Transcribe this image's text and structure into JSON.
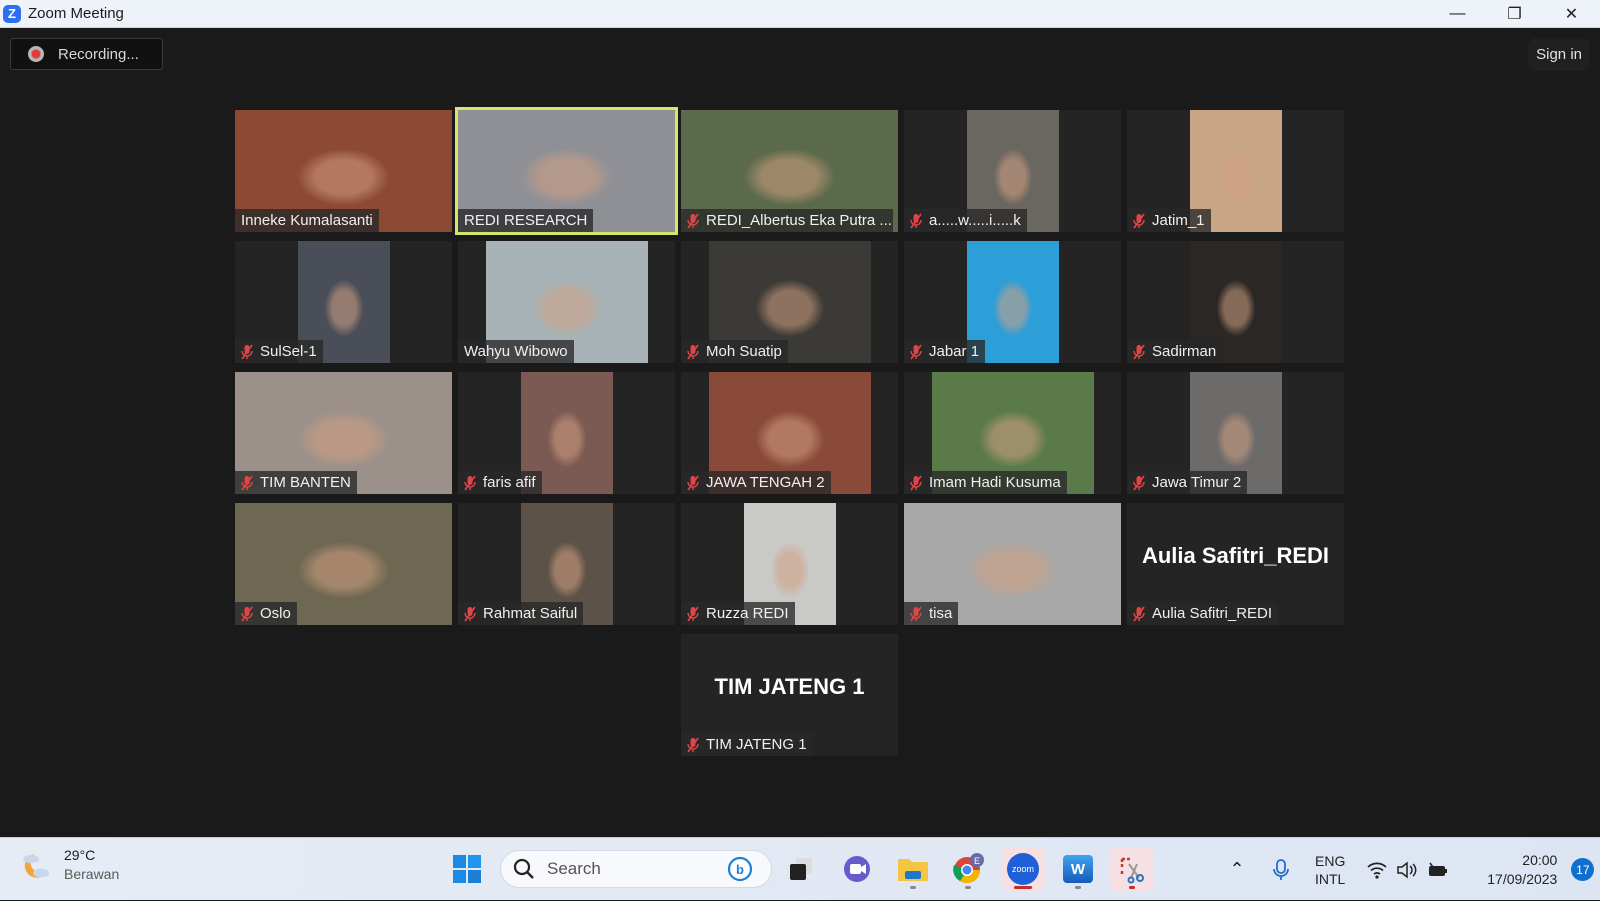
{
  "window": {
    "title": "Zoom Meeting",
    "app_icon_letter": "Z",
    "controls": {
      "minimize": "—",
      "restore": "❐",
      "close": "✕"
    }
  },
  "meeting": {
    "recording_label": "Recording...",
    "sign_in_label": "Sign in",
    "active_speaker_color": "#d6e66a",
    "participants": [
      {
        "name": "Inneke Kumalasanti",
        "muted": false,
        "video": true,
        "active": false,
        "bg": "#8d4a33"
      },
      {
        "name": "REDI RESEARCH",
        "muted": false,
        "video": true,
        "active": true,
        "bg": "#8e9096"
      },
      {
        "name": "REDI_Albertus Eka Putra ...",
        "muted": true,
        "video": true,
        "active": false,
        "bg": "#5b6a4a"
      },
      {
        "name": "a.....w.....i.....k",
        "muted": true,
        "video": true,
        "active": false,
        "bg": "#6a6660",
        "narrow": true
      },
      {
        "name": "Jatim_1",
        "muted": true,
        "video": true,
        "active": false,
        "bg": "#c8a585",
        "narrow": true
      },
      {
        "name": "SulSel-1",
        "muted": true,
        "video": true,
        "active": false,
        "bg": "#4a4e58",
        "narrow": true
      },
      {
        "name": "Wahyu Wibowo",
        "muted": false,
        "video": true,
        "active": false,
        "bg": "#a7b3b6",
        "medium": true
      },
      {
        "name": "Moh Suatip",
        "muted": true,
        "video": true,
        "active": false,
        "bg": "#3c3a36",
        "medium": true
      },
      {
        "name": "Jabar 1",
        "muted": true,
        "video": true,
        "active": false,
        "bg": "#2c9ed8",
        "narrow": true
      },
      {
        "name": "Sadirman",
        "muted": true,
        "video": true,
        "active": false,
        "bg": "#2a2724",
        "narrow": true
      },
      {
        "name": "TIM BANTEN",
        "muted": true,
        "video": true,
        "active": false,
        "bg": "#9b918a"
      },
      {
        "name": "faris afif",
        "muted": true,
        "video": true,
        "active": false,
        "bg": "#7a5a52",
        "narrow": true
      },
      {
        "name": "JAWA TENGAH 2",
        "muted": true,
        "video": true,
        "active": false,
        "bg": "#8a4a3a",
        "medium": true
      },
      {
        "name": "Imam Hadi Kusuma",
        "muted": true,
        "video": true,
        "active": false,
        "bg": "#5a7a4a",
        "medium": true
      },
      {
        "name": "Jawa Timur 2",
        "muted": true,
        "video": true,
        "active": false,
        "bg": "#6d6a6a",
        "narrow": true
      },
      {
        "name": "Oslo",
        "muted": true,
        "video": true,
        "active": false,
        "bg": "#6e6752"
      },
      {
        "name": "Rahmat Saiful",
        "muted": true,
        "video": true,
        "active": false,
        "bg": "#5d5248",
        "narrow": true
      },
      {
        "name": "Ruzza REDI",
        "muted": true,
        "video": true,
        "active": false,
        "bg": "#c9c9c6",
        "narrow": true
      },
      {
        "name": "tisa",
        "muted": true,
        "video": true,
        "active": false,
        "bg": "#a8a8a8"
      },
      {
        "name": "Aulia Safitri_REDI",
        "muted": true,
        "video": false,
        "active": false,
        "bg": "#242424"
      },
      {
        "name": "TIM JATENG 1",
        "muted": true,
        "video": false,
        "active": false,
        "bg": "#242424"
      }
    ]
  },
  "taskbar": {
    "weather": {
      "temp": "29°C",
      "desc": "Berawan"
    },
    "search_placeholder": "Search",
    "apps": [
      {
        "name": "start",
        "icon": "windows-icon"
      },
      {
        "name": "task-view",
        "icon": "task-view-icon"
      },
      {
        "name": "teams-meet",
        "icon": "video-chat-icon"
      },
      {
        "name": "file-explorer",
        "icon": "folder-icon"
      },
      {
        "name": "chrome",
        "icon": "chrome-icon",
        "badge": "E"
      },
      {
        "name": "zoom",
        "icon": "zoom-icon",
        "label": "zoom"
      },
      {
        "name": "word",
        "icon": "word-icon",
        "label": "W"
      },
      {
        "name": "snipping-tool",
        "icon": "snipping-icon"
      }
    ],
    "tray": {
      "lang_line1": "ENG",
      "lang_line2": "INTL",
      "time": "20:00",
      "date": "17/09/2023",
      "notifications": "17"
    }
  }
}
